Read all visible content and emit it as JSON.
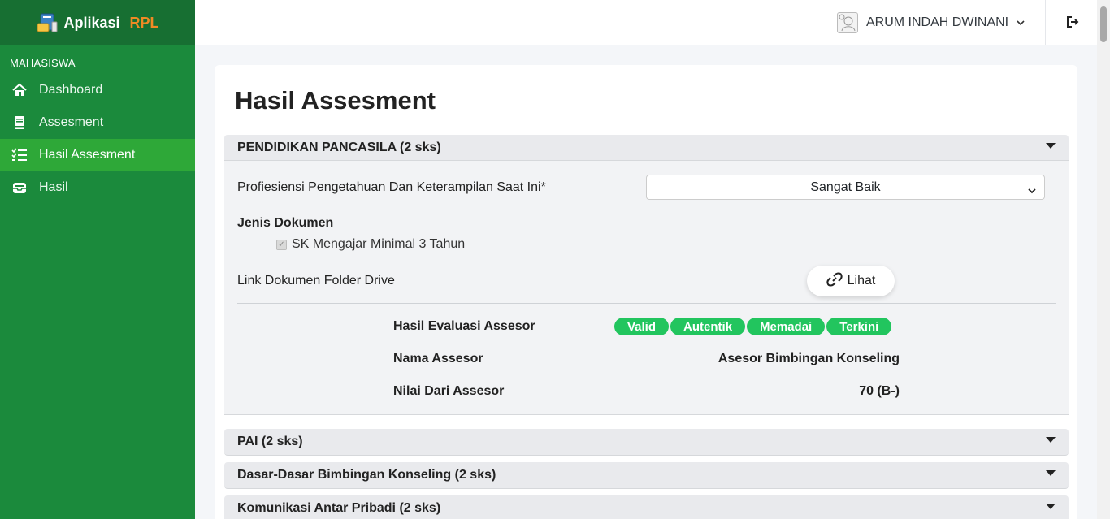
{
  "brand": {
    "name": "Aplikasi",
    "accent": "RPL"
  },
  "sidebar": {
    "section": "MAHASISWA",
    "items": [
      {
        "label": "Dashboard",
        "icon": "home-icon"
      },
      {
        "label": "Assesment",
        "icon": "book-icon"
      },
      {
        "label": "Hasil Assesment",
        "icon": "list-check-icon",
        "active": true
      },
      {
        "label": "Hasil",
        "icon": "inbox-icon"
      }
    ]
  },
  "topbar": {
    "user_name": "ARUM INDAH DWINANI"
  },
  "main": {
    "title": "Hasil Assesment",
    "courses": [
      {
        "title": "PENDIDIKAN PANCASILA (2 sks)",
        "proficiency_label": "Profiesiensi Pengetahuan Dan Keterampilan Saat Ini*",
        "proficiency_value": "Sangat Baik",
        "doc_type_label": "Jenis Dokumen",
        "doc_item": "SK Mengajar Minimal 3 Tahun",
        "link_label": "Link Dokumen Folder Drive",
        "link_button": "Lihat",
        "eval_label": "Hasil Evaluasi Assesor",
        "eval_badges": [
          "Valid",
          "Autentik",
          "Memadai",
          "Terkini"
        ],
        "assessor_label": "Nama Assesor",
        "assessor_name": "Asesor Bimbingan Konseling",
        "score_label": "Nilai Dari Assesor",
        "score_value": "70 (B-)"
      },
      {
        "title": "PAI (2 sks)"
      },
      {
        "title": "Dasar-Dasar Bimbingan Konseling (2 sks)"
      },
      {
        "title": "Komunikasi Antar Pribadi (2 sks)"
      }
    ]
  },
  "colors": {
    "sidebar": "#1b8a3c",
    "sidebar_active": "#2ea838",
    "brand_accent": "#f08a24",
    "badge": "#22c55e"
  }
}
